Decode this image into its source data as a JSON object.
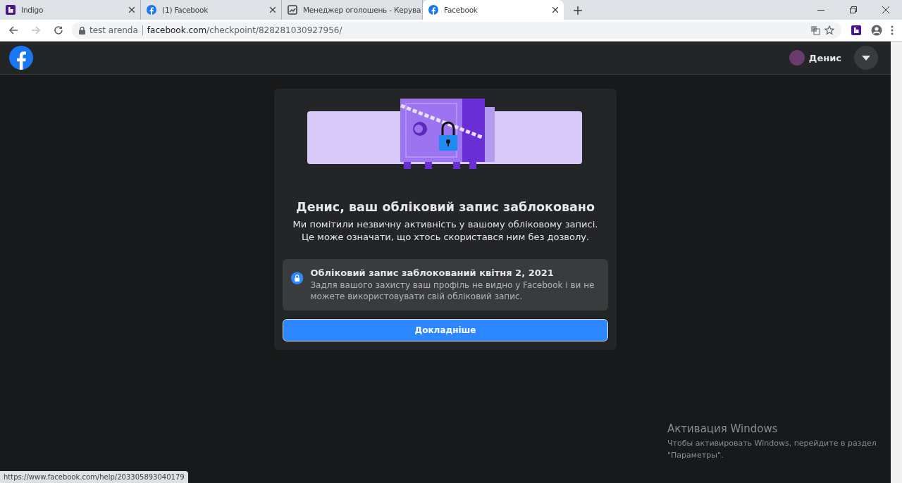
{
  "browser": {
    "tabs": [
      {
        "title": "Indigo",
        "selected": false
      },
      {
        "title": "(1) Facebook",
        "selected": false
      },
      {
        "title": "Менеджер оголошень - Керува",
        "selected": false
      },
      {
        "title": "Facebook",
        "selected": true
      }
    ],
    "address": {
      "site_label": "test arenda",
      "domain": "facebook.com",
      "path": "/checkpoint/828281030927956/"
    },
    "status_url": "https://www.facebook.com/help/203305893040179"
  },
  "header": {
    "user_name": "Денис"
  },
  "card": {
    "title": "Денис, ваш обліковий запис заблоковано",
    "description": "Ми помітили незвичну активність у вашому обліковому записі. Це може означати, що хтось скористався ним без дозволу.",
    "notice": {
      "title": "Обліковий запис заблокований квітня 2, 2021",
      "text": "Задля вашого захисту ваш профіль не видно у Facebook і ви не можете використовувати свій обліковий запис."
    },
    "button": "Докладніше"
  },
  "windows_activation": {
    "title": "Активация Windows",
    "text": "Чтобы активировать Windows, перейдите в раздел \"Параметры\"."
  }
}
